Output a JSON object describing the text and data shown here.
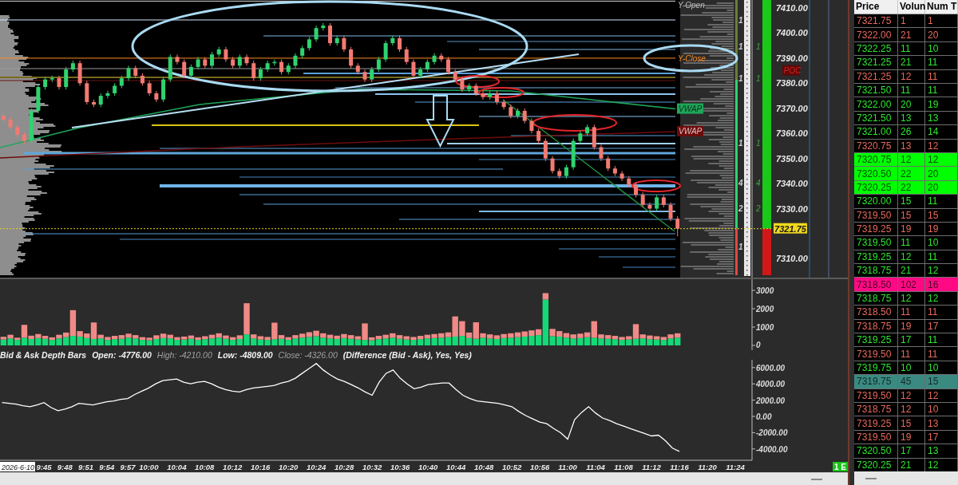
{
  "price_panel": {
    "level_labels": [
      {
        "kind": "y-open",
        "text": "Y-Open"
      },
      {
        "kind": "y-close",
        "text": "Y-Close"
      },
      {
        "kind": "vwap",
        "text": "VWAP",
        "color": "#1fa65a"
      },
      {
        "kind": "vwap",
        "text": "VWAP",
        "color": "#6e0c0c"
      }
    ],
    "poc_label": "POC",
    "profile_counts": [
      "1",
      "1",
      "1",
      "1",
      "4",
      "2",
      "1"
    ],
    "depth_counts": [
      "1",
      "1",
      "1",
      "4",
      "2"
    ],
    "last_price": "7321.75",
    "chart_data": {
      "type": "candlestick",
      "categories": [
        null,
        null,
        null,
        null,
        null,
        null,
        null,
        null,
        null,
        null,
        null,
        null,
        null,
        null,
        null,
        null,
        null,
        null,
        null,
        null,
        null,
        null,
        null,
        null,
        null,
        null,
        null,
        null,
        null,
        null,
        null,
        null,
        null,
        null,
        null,
        null,
        null,
        null,
        null,
        null,
        null,
        null,
        null,
        null,
        null,
        null,
        null,
        null,
        null,
        null,
        null,
        null,
        null,
        null,
        null,
        null,
        null,
        null,
        null,
        null,
        null,
        null,
        null,
        null,
        null,
        null,
        null,
        null,
        null,
        null,
        null,
        null,
        null,
        null,
        null,
        null,
        null,
        null,
        null,
        null,
        null,
        null,
        null,
        null,
        null,
        null,
        null,
        null,
        null,
        null,
        null,
        null,
        null,
        null,
        null,
        null,
        null,
        null,
        null,
        null,
        null,
        null,
        null,
        null,
        null,
        null,
        null,
        null,
        null,
        null,
        null,
        null,
        null,
        null,
        null,
        null,
        null,
        null,
        null,
        null,
        null,
        null
      ],
      "ohlc": [
        [
          7367,
          7368,
          7364.5,
          7365.5
        ],
        [
          7365.5,
          7366.5,
          7361.5,
          7362.5
        ],
        [
          7362.5,
          7363.5,
          7358.5,
          7359.5
        ],
        [
          7359.5,
          7360.5,
          7356,
          7357
        ],
        [
          7357,
          7370,
          7356,
          7369
        ],
        [
          7369,
          7379.5,
          7368,
          7378.5
        ],
        [
          7378.5,
          7382.5,
          7377.5,
          7381.5
        ],
        [
          7381.5,
          7383,
          7380.5,
          7382
        ],
        [
          7382,
          7383,
          7377.5,
          7378.5
        ],
        [
          7378.5,
          7386.5,
          7377.5,
          7385.5
        ],
        [
          7385.5,
          7389,
          7384.5,
          7388
        ],
        [
          7388,
          7389,
          7379,
          7380
        ],
        [
          7380,
          7381,
          7371.5,
          7372.5
        ],
        [
          7372.5,
          7373.5,
          7370.5,
          7371.5
        ],
        [
          7371.5,
          7376,
          7370.5,
          7375
        ],
        [
          7375,
          7377,
          7374,
          7376
        ],
        [
          7376,
          7380,
          7375,
          7379
        ],
        [
          7379,
          7383,
          7378,
          7382
        ],
        [
          7382,
          7387,
          7381,
          7386
        ],
        [
          7386,
          7387,
          7382,
          7383
        ],
        [
          7383,
          7384,
          7379,
          7380
        ],
        [
          7380,
          7381,
          7375,
          7376
        ],
        [
          7376,
          7377,
          7372.5,
          7373.5
        ],
        [
          7373.5,
          7382.5,
          7372.5,
          7381.5
        ],
        [
          7381.5,
          7391.5,
          7380.5,
          7390.5
        ],
        [
          7390.5,
          7391.5,
          7387.5,
          7388.5
        ],
        [
          7388.5,
          7389.5,
          7382,
          7383
        ],
        [
          7383,
          7387.5,
          7382,
          7386.5
        ],
        [
          7386.5,
          7390.5,
          7385.5,
          7389.5
        ],
        [
          7389.5,
          7390.5,
          7386,
          7387
        ],
        [
          7387,
          7392.5,
          7386,
          7391.5
        ],
        [
          7391.5,
          7394.5,
          7390.5,
          7393.5
        ],
        [
          7393.5,
          7394.5,
          7388.5,
          7389.5
        ],
        [
          7389.5,
          7390.5,
          7386,
          7387
        ],
        [
          7387,
          7391.5,
          7386,
          7390.5
        ],
        [
          7390.5,
          7391.5,
          7387,
          7388
        ],
        [
          7388,
          7389,
          7381,
          7382
        ],
        [
          7382,
          7386.5,
          7381,
          7385.5
        ],
        [
          7385.5,
          7389,
          7384.5,
          7388
        ],
        [
          7388,
          7389.5,
          7387,
          7388.5
        ],
        [
          7388.5,
          7389.5,
          7383.5,
          7384.5
        ],
        [
          7384.5,
          7388,
          7383.5,
          7387
        ],
        [
          7387,
          7392,
          7386,
          7391
        ],
        [
          7391,
          7395,
          7390,
          7394
        ],
        [
          7394,
          7398.5,
          7393,
          7397.5
        ],
        [
          7397.5,
          7403,
          7396.5,
          7402
        ],
        [
          7402,
          7404,
          7401,
          7403
        ],
        [
          7403,
          7404,
          7395,
          7396
        ],
        [
          7396,
          7399,
          7395,
          7398
        ],
        [
          7398,
          7399,
          7392.5,
          7393.5
        ],
        [
          7393.5,
          7394.5,
          7386,
          7387
        ],
        [
          7387,
          7388,
          7383.5,
          7384.5
        ],
        [
          7384.5,
          7385.5,
          7380.5,
          7381.5
        ],
        [
          7381.5,
          7386.5,
          7380.5,
          7385.5
        ],
        [
          7385.5,
          7390.5,
          7384.5,
          7389.5
        ],
        [
          7389.5,
          7397,
          7388.5,
          7396
        ],
        [
          7396,
          7399,
          7395,
          7398
        ],
        [
          7398,
          7399,
          7392.5,
          7393.5
        ],
        [
          7393.5,
          7394.5,
          7387.5,
          7388.5
        ],
        [
          7388.5,
          7389.5,
          7382,
          7383
        ],
        [
          7383,
          7386.5,
          7382,
          7385.5
        ],
        [
          7385.5,
          7389.5,
          7384.5,
          7388.5
        ],
        [
          7388.5,
          7392,
          7387.5,
          7391
        ],
        [
          7391,
          7392,
          7388.5,
          7389.5
        ],
        [
          7389.5,
          7390.5,
          7383.5,
          7384.5
        ],
        [
          7384.5,
          7385.5,
          7380.5,
          7381.5
        ],
        [
          7381.5,
          7382.5,
          7376.5,
          7377.5
        ],
        [
          7377.5,
          7380,
          7376.5,
          7379
        ],
        [
          7379,
          7380,
          7375,
          7376
        ],
        [
          7376,
          7377,
          7373.5,
          7374.5
        ],
        [
          7374.5,
          7377,
          7373.5,
          7376
        ],
        [
          7376,
          7377,
          7371.5,
          7372.5
        ],
        [
          7372.5,
          7373.5,
          7369.5,
          7370.5
        ],
        [
          7370.5,
          7371.5,
          7366,
          7367
        ],
        [
          7367,
          7370,
          7366,
          7369
        ],
        [
          7369,
          7370,
          7364,
          7365
        ],
        [
          7365,
          7366,
          7360,
          7361
        ],
        [
          7361,
          7362,
          7356,
          7357
        ],
        [
          7357,
          7358,
          7349,
          7350
        ],
        [
          7350,
          7351,
          7344,
          7345
        ],
        [
          7345,
          7346,
          7342,
          7343
        ],
        [
          7343,
          7347.5,
          7342,
          7346.5
        ],
        [
          7346.5,
          7358,
          7345.5,
          7357
        ],
        [
          7357,
          7361,
          7356,
          7360
        ],
        [
          7360,
          7363.5,
          7359,
          7362.5
        ],
        [
          7362.5,
          7363.5,
          7353.5,
          7354.5
        ],
        [
          7354.5,
          7355.5,
          7349,
          7350
        ],
        [
          7350,
          7351,
          7345,
          7346
        ],
        [
          7346,
          7347,
          7343,
          7344
        ],
        [
          7344,
          7345,
          7341,
          7342
        ],
        [
          7342,
          7343,
          7338.5,
          7339.5
        ],
        [
          7339.5,
          7340.5,
          7334.5,
          7335.5
        ],
        [
          7335.5,
          7336.5,
          7330.5,
          7331.5
        ],
        [
          7331.5,
          7332.5,
          7329,
          7330
        ],
        [
          7330,
          7335.5,
          7329,
          7334.5
        ],
        [
          7334.5,
          7335.5,
          7330.5,
          7331.5
        ],
        [
          7331.5,
          7332.5,
          7325,
          7326
        ],
        [
          7326,
          7327,
          7319,
          7322
        ],
        null,
        null,
        null,
        null,
        null,
        null,
        null,
        null,
        null,
        null,
        null,
        null,
        null,
        null,
        null,
        null,
        null,
        null,
        null,
        null,
        null,
        null,
        null,
        null
      ],
      "ylim": [
        7302.5,
        7413.2
      ],
      "yticks": [
        {
          "value": 7410,
          "label": "7410.00"
        },
        {
          "value": 7400,
          "label": "7400.00"
        },
        {
          "value": 7390,
          "label": "7390.00"
        },
        {
          "value": 7380,
          "label": "7380.00"
        },
        {
          "value": 7370,
          "label": "7370.00"
        },
        {
          "value": 7360,
          "label": "7360.00"
        },
        {
          "value": 7350,
          "label": "7350.00"
        },
        {
          "value": 7340,
          "label": "7340.00"
        },
        {
          "value": 7330,
          "label": "7330.00"
        },
        {
          "value": 7310,
          "label": "7310.00"
        }
      ]
    }
  },
  "volume_panel": {
    "chart_data": {
      "type": "bar",
      "stacked": true,
      "categories": [
        null,
        null,
        null,
        null,
        null,
        null,
        null,
        null,
        null,
        null,
        null,
        null,
        null,
        null,
        null,
        null,
        null,
        null,
        null,
        null,
        null,
        null,
        null,
        null,
        null,
        null,
        null,
        null,
        null,
        null,
        null,
        null,
        null,
        null,
        null,
        null,
        null,
        null,
        null,
        null,
        null,
        null,
        null,
        null,
        null,
        null,
        null,
        null,
        null,
        null,
        null,
        null,
        null,
        null,
        null,
        null,
        null,
        null,
        null,
        null,
        null,
        null,
        null,
        null,
        null,
        null,
        null,
        null,
        null,
        null,
        null,
        null,
        null,
        null,
        null,
        null,
        null,
        null,
        null,
        null,
        null,
        null,
        null,
        null,
        null,
        null,
        null,
        null,
        null,
        null,
        null,
        null,
        null,
        null,
        null,
        null,
        null,
        null,
        null,
        null,
        null,
        null,
        null,
        null,
        null,
        null,
        null,
        null,
        null,
        null,
        null,
        null,
        null,
        null,
        null,
        null,
        null,
        null,
        null,
        null,
        null,
        null
      ],
      "series": [
        {
          "color": "#14d977",
          "values": [
            320,
            380,
            300,
            420,
            350,
            400,
            360,
            300,
            380,
            450,
            520,
            480,
            400,
            350,
            380,
            300,
            340,
            360,
            420,
            380,
            300,
            280,
            350,
            400,
            380,
            300,
            320,
            360,
            300,
            340,
            380,
            420,
            360,
            300,
            350,
            600,
            380,
            320,
            300,
            340,
            360,
            300,
            380,
            420,
            460,
            500,
            420,
            380,
            350,
            400,
            360,
            320,
            300,
            280,
            340,
            380,
            420,
            360,
            320,
            300,
            340,
            380,
            400,
            420,
            450,
            480,
            520,
            400,
            360,
            420,
            380,
            350,
            400,
            420,
            450,
            480,
            520,
            560,
            2500,
            500,
            480,
            420,
            380,
            400,
            450,
            420,
            380,
            360,
            340,
            300,
            320,
            360,
            380,
            340,
            320,
            300,
            380,
            420,
            null,
            null,
            null,
            null,
            null,
            null,
            null,
            null,
            null,
            null,
            null,
            null,
            null,
            null,
            null,
            null,
            null,
            null,
            null,
            null,
            null,
            null,
            null,
            null
          ]
        },
        {
          "color": "#f08a86",
          "values": [
            150,
            200,
            120,
            700,
            180,
            220,
            160,
            140,
            200,
            250,
            1400,
            300,
            250,
            900,
            200,
            160,
            180,
            200,
            220,
            180,
            150,
            140,
            200,
            240,
            200,
            150,
            160,
            180,
            140,
            160,
            200,
            240,
            180,
            150,
            200,
            1700,
            220,
            180,
            160,
            900,
            200,
            150,
            180,
            220,
            260,
            300,
            240,
            200,
            180,
            220,
            200,
            180,
            900,
            160,
            180,
            200,
            240,
            200,
            180,
            160,
            180,
            200,
            220,
            240,
            260,
            1100,
            800,
            300,
            900,
            240,
            220,
            200,
            220,
            240,
            260,
            280,
            300,
            320,
            350,
            400,
            300,
            250,
            220,
            240,
            260,
            900,
            220,
            200,
            180,
            160,
            180,
            800,
            220,
            200,
            180,
            160,
            220,
            240,
            null,
            null,
            null,
            null,
            null,
            null,
            null,
            null,
            null,
            null,
            null,
            null,
            null,
            null,
            null,
            null,
            null,
            null,
            null,
            null,
            null,
            null,
            null,
            null
          ]
        }
      ],
      "ylim": [
        -261,
        3609
      ],
      "yticks": [
        0,
        1000,
        2000,
        3000
      ]
    }
  },
  "study_title": {
    "name": "Bid & Ask Depth Bars",
    "stats": [
      {
        "text": "Open: -4776.00",
        "muted": false
      },
      {
        "text": "High: -4210.00",
        "muted": true
      },
      {
        "text": "Low: -4809.00",
        "muted": false
      },
      {
        "text": "Close: -4326.00",
        "muted": true
      }
    ],
    "params": "(Difference (Bid - Ask), Yes, Yes)"
  },
  "depth_panel": {
    "chart_data": {
      "type": "line",
      "x": [
        579,
        580,
        581,
        582,
        583,
        584,
        585,
        586,
        587,
        588,
        589,
        590,
        591,
        592,
        593,
        594,
        595,
        596,
        597,
        598,
        599,
        600,
        601,
        602,
        603,
        604,
        605,
        606,
        607,
        608,
        609,
        610,
        611,
        612,
        613,
        614,
        615,
        616,
        617,
        618,
        619,
        620,
        621,
        622,
        623,
        624,
        625,
        626,
        627,
        628,
        629,
        630,
        631,
        632,
        633,
        634,
        635,
        636,
        637,
        638,
        639,
        640,
        641,
        642,
        643,
        644,
        645,
        646,
        647,
        648,
        649,
        650,
        651,
        652,
        653,
        654,
        655,
        656,
        657,
        658,
        659,
        660,
        661,
        662,
        663,
        664,
        665,
        666,
        667,
        668,
        669,
        670,
        671,
        672,
        673,
        674,
        675,
        676
      ],
      "series": [
        {
          "color": "#ffffff",
          "values": [
            1700,
            1600,
            1500,
            1300,
            1200,
            1400,
            1700,
            1100,
            700,
            900,
            1200,
            1600,
            1500,
            1400,
            1600,
            1800,
            1900,
            2100,
            2200,
            2700,
            3100,
            3500,
            4000,
            4400,
            4500,
            4600,
            4200,
            4000,
            4200,
            4300,
            4000,
            3600,
            3300,
            3100,
            3000,
            3300,
            3500,
            3600,
            3700,
            3800,
            4100,
            4300,
            4700,
            5300,
            5900,
            6500,
            5700,
            5100,
            4600,
            4300,
            3900,
            3500,
            3000,
            2600,
            4200,
            5300,
            5700,
            4700,
            4000,
            3400,
            3600,
            3900,
            4000,
            4100,
            4100,
            3300,
            2600,
            2200,
            1900,
            1800,
            1700,
            1600,
            1400,
            1200,
            600,
            100,
            -300,
            -700,
            -900,
            -1500,
            -2000,
            -2800,
            -400,
            500,
            1200,
            400,
            -200,
            -500,
            -900,
            -1200,
            -1500,
            -1800,
            -2100,
            -2400,
            -2300,
            -3000,
            -3900,
            -4300
          ]
        }
      ],
      "xlim": [
        578.7,
        686.4
      ],
      "ylim": [
        -5392,
        6961
      ],
      "yticks": [
        {
          "value": 6000,
          "label": "6000.00"
        },
        {
          "value": 4000,
          "label": "4000.00"
        },
        {
          "value": 2000,
          "label": "2000.00"
        },
        {
          "value": 0,
          "label": "0.00"
        },
        {
          "value": -2000,
          "label": "-2000.00"
        },
        {
          "value": -4000,
          "label": "-4000.00"
        }
      ],
      "xticks": [
        {
          "value": 585,
          "label": "9:45"
        },
        {
          "value": 588,
          "label": "9:48"
        },
        {
          "value": 591,
          "label": "9:51"
        },
        {
          "value": 594,
          "label": "9:54"
        },
        {
          "value": 597,
          "label": "9:57"
        },
        {
          "value": 600,
          "label": "10:00"
        },
        {
          "value": 604,
          "label": "10:04"
        },
        {
          "value": 608,
          "label": "10:08"
        },
        {
          "value": 612,
          "label": "10:12"
        },
        {
          "value": 616,
          "label": "10:16"
        },
        {
          "value": 620,
          "label": "10:20"
        },
        {
          "value": 624,
          "label": "10:24"
        },
        {
          "value": 628,
          "label": "10:28"
        },
        {
          "value": 632,
          "label": "10:32"
        },
        {
          "value": 636,
          "label": "10:36"
        },
        {
          "value": 640,
          "label": "10:40"
        },
        {
          "value": 644,
          "label": "10:44"
        },
        {
          "value": 648,
          "label": "10:48"
        },
        {
          "value": 652,
          "label": "10:52"
        },
        {
          "value": 656,
          "label": "10:56"
        },
        {
          "value": 660,
          "label": "11:00"
        },
        {
          "value": 664,
          "label": "11:04"
        },
        {
          "value": 668,
          "label": "11:08"
        },
        {
          "value": 672,
          "label": "11:12"
        },
        {
          "value": 676,
          "label": "11:16"
        },
        {
          "value": 680,
          "label": "11:20"
        },
        {
          "value": 684,
          "label": "11:24"
        }
      ]
    },
    "date": "2026-6-10",
    "badge": "1 E"
  },
  "time_and_sales": {
    "columns": [
      "Price",
      "Volun",
      "Num T"
    ],
    "rows": [
      {
        "price": "7321.75",
        "volume": "1",
        "trades": "1",
        "kind": "sell"
      },
      {
        "price": "7322.00",
        "volume": "21",
        "trades": "20",
        "kind": "sell"
      },
      {
        "price": "7322.25",
        "volume": "11",
        "trades": "10",
        "kind": "buy"
      },
      {
        "price": "7321.25",
        "volume": "21",
        "trades": "11",
        "kind": "buy"
      },
      {
        "price": "7321.25",
        "volume": "12",
        "trades": "11",
        "kind": "sell"
      },
      {
        "price": "7321.50",
        "volume": "11",
        "trades": "11",
        "kind": "buy"
      },
      {
        "price": "7322.00",
        "volume": "20",
        "trades": "19",
        "kind": "buy"
      },
      {
        "price": "7321.50",
        "volume": "13",
        "trades": "13",
        "kind": "buy"
      },
      {
        "price": "7321.00",
        "volume": "26",
        "trades": "14",
        "kind": "buy"
      },
      {
        "price": "7320.75",
        "volume": "13",
        "trades": "12",
        "kind": "sell"
      },
      {
        "price": "7320.75",
        "volume": "12",
        "trades": "12",
        "kind": "buy",
        "color": "#00ff00"
      },
      {
        "price": "7320.50",
        "volume": "22",
        "trades": "20",
        "kind": "buy",
        "color": "#00ff00"
      },
      {
        "price": "7320.25",
        "volume": "22",
        "trades": "20",
        "kind": "buy",
        "color": "#00ff00"
      },
      {
        "price": "7320.00",
        "volume": "15",
        "trades": "11",
        "kind": "buy"
      },
      {
        "price": "7319.50",
        "volume": "15",
        "trades": "15",
        "kind": "sell"
      },
      {
        "price": "7319.25",
        "volume": "19",
        "trades": "19",
        "kind": "sell"
      },
      {
        "price": "7319.50",
        "volume": "11",
        "trades": "10",
        "kind": "buy"
      },
      {
        "price": "7319.25",
        "volume": "12",
        "trades": "11",
        "kind": "buy"
      },
      {
        "price": "7318.75",
        "volume": "21",
        "trades": "12",
        "kind": "buy"
      },
      {
        "price": "7318.50",
        "volume": "102",
        "trades": "16",
        "kind": "sell",
        "color": "#ff0a84"
      },
      {
        "price": "7318.75",
        "volume": "12",
        "trades": "12",
        "kind": "buy"
      },
      {
        "price": "7318.50",
        "volume": "11",
        "trades": "11",
        "kind": "sell"
      },
      {
        "price": "7318.75",
        "volume": "19",
        "trades": "17",
        "kind": "sell"
      },
      {
        "price": "7319.25",
        "volume": "17",
        "trades": "11",
        "kind": "buy"
      },
      {
        "price": "7319.50",
        "volume": "11",
        "trades": "11",
        "kind": "sell"
      },
      {
        "price": "7319.75",
        "volume": "10",
        "trades": "10",
        "kind": "buy"
      },
      {
        "price": "7319.75",
        "volume": "45",
        "trades": "15",
        "kind": "buy",
        "color": "#3a8a82"
      },
      {
        "price": "7319.50",
        "volume": "12",
        "trades": "12",
        "kind": "sell"
      },
      {
        "price": "7318.75",
        "volume": "12",
        "trades": "10",
        "kind": "sell"
      },
      {
        "price": "7319.25",
        "volume": "15",
        "trades": "13",
        "kind": "sell"
      },
      {
        "price": "7319.50",
        "volume": "19",
        "trades": "17",
        "kind": "sell"
      },
      {
        "price": "7320.50",
        "volume": "17",
        "trades": "13",
        "kind": "buy"
      },
      {
        "price": "7320.25",
        "volume": "21",
        "trades": "12",
        "kind": "buy"
      }
    ]
  }
}
